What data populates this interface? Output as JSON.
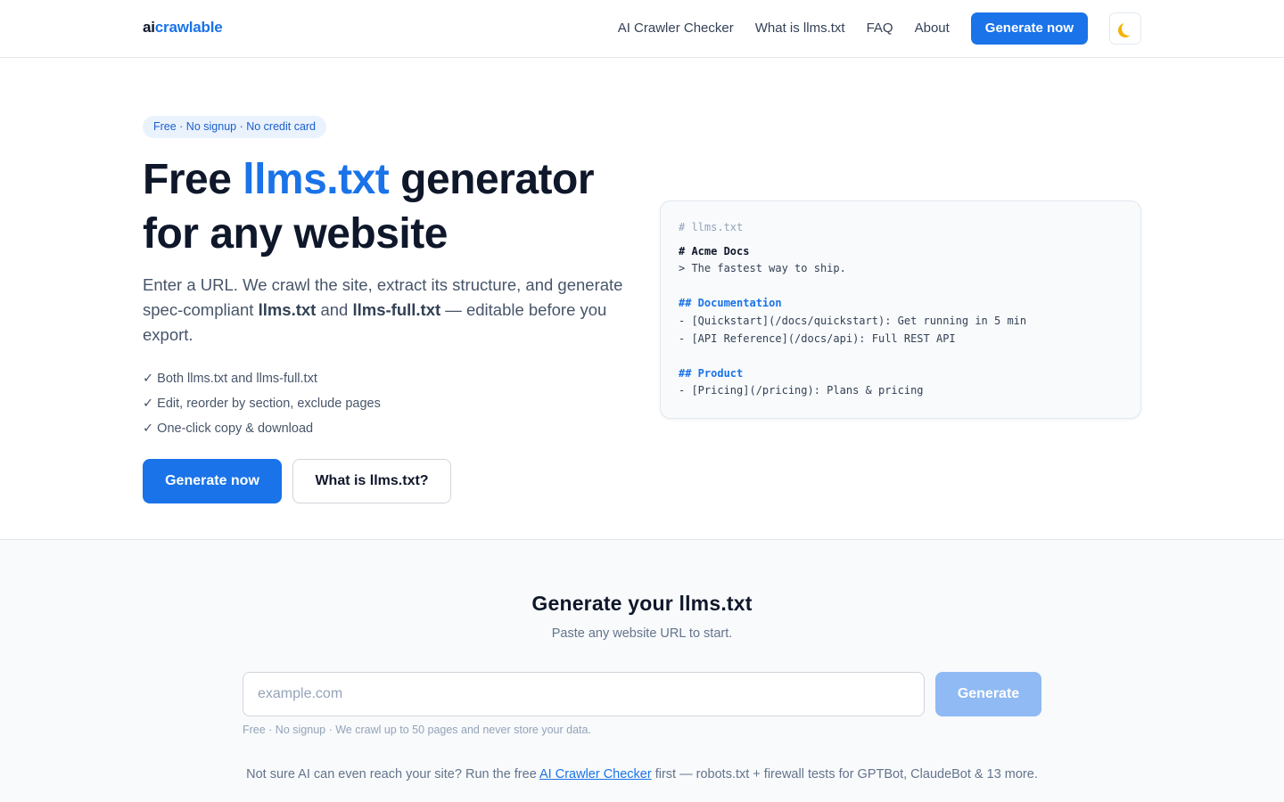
{
  "header": {
    "logo_ai": "ai",
    "logo_rest": "crawlable",
    "nav": [
      "AI Crawler Checker",
      "What is llms.txt",
      "FAQ",
      "About"
    ],
    "cta_label": "Generate now",
    "theme_icon": "moon-icon"
  },
  "hero": {
    "badge": "Free · No signup · No credit card",
    "title_pre": "Free ",
    "title_accent": "llms.txt",
    "title_post": " generator for any website",
    "desc_1": "Enter a URL. We crawl the site, extract its structure, and generate spec-compliant ",
    "desc_b1": "llms.txt",
    "desc_2": " and ",
    "desc_b2": "llms-full.txt",
    "desc_3": " — editable before you export.",
    "features": [
      "✓ Both llms.txt and llms-full.txt",
      "✓ Edit, reorder by section, exclude pages",
      "✓ One-click copy & download"
    ],
    "primary_label": "Generate now",
    "secondary_label": "What is llms.txt?"
  },
  "code_preview": {
    "comment": "# llms.txt",
    "h1": "# Acme Docs",
    "quote": "> The fastest way to ship.",
    "section1": "## Documentation",
    "item1": "- [Quickstart](/docs/quickstart): Get running in 5 min",
    "item2": "- [API Reference](/docs/api): Full REST API",
    "section2": "## Product",
    "item3": "- [Pricing](/pricing): Plans & pricing"
  },
  "generator": {
    "title": "Generate your llms.txt",
    "subtitle": "Paste any website URL to start.",
    "placeholder": "example.com",
    "value": "",
    "button_label": "Generate",
    "note": "Free · No signup · We crawl up to 50 pages and never store your data.",
    "hint_pre": "Not sure AI can even reach your site? Run the free ",
    "hint_link": "AI Crawler Checker",
    "hint_post": " first — robots.txt + firewall tests for GPTBot, ClaudeBot & 13 more."
  },
  "colors": {
    "accent": "#1a73e8",
    "disabled_button": "#8fbaf3",
    "section_bg": "#f8fafc"
  }
}
